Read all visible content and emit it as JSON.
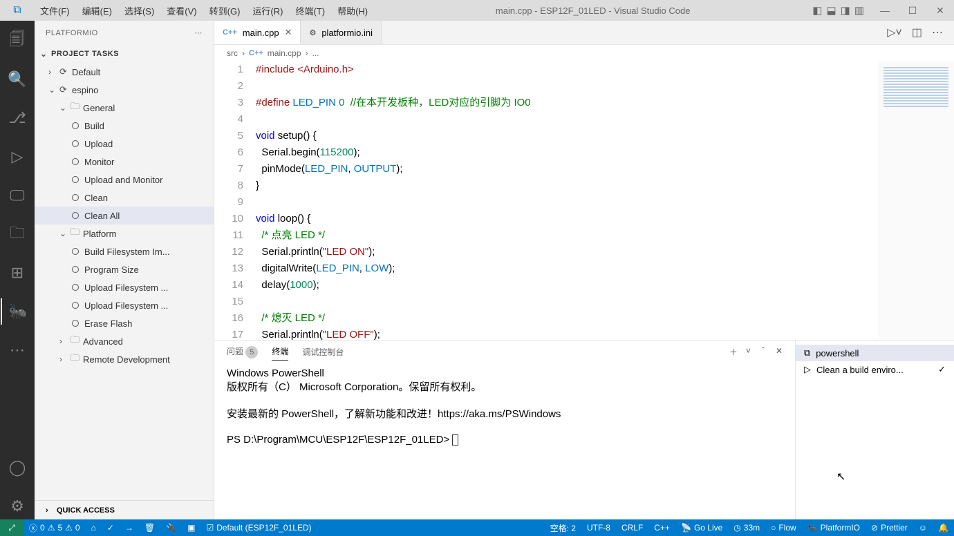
{
  "titlebar": {
    "title": "main.cpp - ESP12F_01LED - Visual Studio Code"
  },
  "menu": [
    "文件(F)",
    "编辑(E)",
    "选择(S)",
    "查看(V)",
    "转到(G)",
    "运行(R)",
    "终端(T)",
    "帮助(H)"
  ],
  "sidebar": {
    "title": "PLATFORMIO",
    "section": "PROJECT TASKS",
    "items": [
      {
        "label": "Default",
        "depth": 1,
        "chev": "›",
        "icon": "⟳"
      },
      {
        "label": "espino",
        "depth": 1,
        "chev": "⌄",
        "icon": "⟳"
      },
      {
        "label": "General",
        "depth": 2,
        "chev": "⌄",
        "icon": "🗀"
      },
      {
        "label": "Build",
        "depth": 3,
        "bullet": true
      },
      {
        "label": "Upload",
        "depth": 3,
        "bullet": true
      },
      {
        "label": "Monitor",
        "depth": 3,
        "bullet": true
      },
      {
        "label": "Upload and Monitor",
        "depth": 3,
        "bullet": true
      },
      {
        "label": "Clean",
        "depth": 3,
        "bullet": true
      },
      {
        "label": "Clean All",
        "depth": 3,
        "bullet": true,
        "selected": true
      },
      {
        "label": "Platform",
        "depth": 2,
        "chev": "⌄",
        "icon": "🗀"
      },
      {
        "label": "Build Filesystem Im...",
        "depth": 3,
        "bullet": true
      },
      {
        "label": "Program Size",
        "depth": 3,
        "bullet": true
      },
      {
        "label": "Upload Filesystem ...",
        "depth": 3,
        "bullet": true
      },
      {
        "label": "Upload Filesystem ...",
        "depth": 3,
        "bullet": true
      },
      {
        "label": "Erase Flash",
        "depth": 3,
        "bullet": true
      },
      {
        "label": "Advanced",
        "depth": 2,
        "chev": "›",
        "icon": "🗀"
      },
      {
        "label": "Remote Development",
        "depth": 2,
        "chev": "›",
        "icon": "🗀"
      }
    ],
    "quick": "QUICK ACCESS"
  },
  "tabs": [
    {
      "label": "main.cpp",
      "icon": "C++",
      "active": true,
      "close": true
    },
    {
      "label": "platformio.ini",
      "icon": "⚙",
      "active": false
    }
  ],
  "breadcrumb": {
    "a": "src",
    "b": "C++",
    "c": "main.cpp",
    "d": "..."
  },
  "code": {
    "lines": [
      "1",
      "2",
      "3",
      "4",
      "5",
      "6",
      "7",
      "8",
      "9",
      "10",
      "11",
      "12",
      "13",
      "14",
      "15",
      "16",
      "17"
    ]
  },
  "panel": {
    "tabs": {
      "problems": "问题",
      "problems_count": "5",
      "terminal": "终端",
      "debug": "调试控制台"
    },
    "terminal": "Windows PowerShell\n版权所有（C） Microsoft Corporation。保留所有权利。\n\n安装最新的 PowerShell，了解新功能和改进！https://aka.ms/PSWindows\n\nPS D:\\Program\\MCU\\ESP12F\\ESP12F_01LED> ",
    "right": [
      {
        "label": "powershell",
        "active": true
      },
      {
        "label": "Clean a build enviro..."
      }
    ]
  },
  "status": {
    "errors": "0",
    "warnings": "5",
    "info": "0",
    "env": "Default (ESP12F_01LED)",
    "spaces": "空格: 2",
    "encoding": "UTF-8",
    "eol": "CRLF",
    "lang": "C++",
    "golive": "Go Live",
    "time": "33m",
    "flow": "Flow",
    "platformio": "PlatformIO",
    "prettier": "Prettier"
  }
}
